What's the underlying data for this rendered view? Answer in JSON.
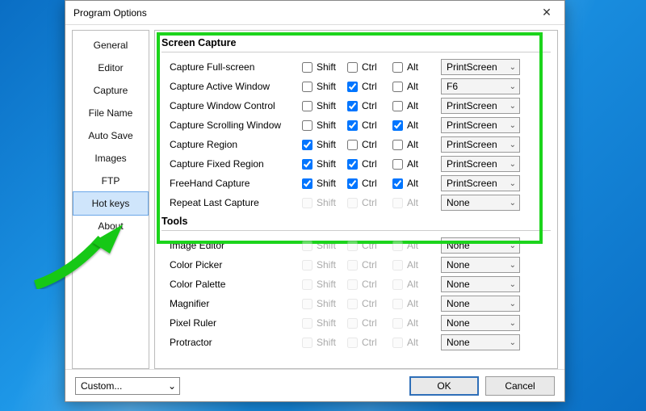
{
  "window": {
    "title": "Program Options"
  },
  "sidebar": {
    "items": [
      {
        "label": "General"
      },
      {
        "label": "Editor"
      },
      {
        "label": "Capture"
      },
      {
        "label": "File Name"
      },
      {
        "label": "Auto Save"
      },
      {
        "label": "Images"
      },
      {
        "label": "FTP"
      },
      {
        "label": "Hot keys",
        "selected": true
      },
      {
        "label": "About"
      }
    ]
  },
  "mods": {
    "shift": "Shift",
    "ctrl": "Ctrl",
    "alt": "Alt"
  },
  "sections": [
    {
      "title": "Screen Capture",
      "highlighted": true,
      "rows": [
        {
          "label": "Capture Full-screen",
          "shift": false,
          "ctrl": false,
          "alt": false,
          "key": "PrintScreen",
          "enabled": true
        },
        {
          "label": "Capture Active Window",
          "shift": false,
          "ctrl": true,
          "alt": false,
          "key": "F6",
          "enabled": true
        },
        {
          "label": "Capture Window Control",
          "shift": false,
          "ctrl": true,
          "alt": false,
          "key": "PrintScreen",
          "enabled": true
        },
        {
          "label": "Capture Scrolling Window",
          "shift": false,
          "ctrl": true,
          "alt": true,
          "key": "PrintScreen",
          "enabled": true
        },
        {
          "label": "Capture Region",
          "shift": true,
          "ctrl": false,
          "alt": false,
          "key": "PrintScreen",
          "enabled": true
        },
        {
          "label": "Capture Fixed Region",
          "shift": true,
          "ctrl": true,
          "alt": false,
          "key": "PrintScreen",
          "enabled": true
        },
        {
          "label": "FreeHand Capture",
          "shift": true,
          "ctrl": true,
          "alt": true,
          "key": "PrintScreen",
          "enabled": true
        },
        {
          "label": "Repeat Last Capture",
          "shift": false,
          "ctrl": false,
          "alt": false,
          "key": "None",
          "enabled": false
        }
      ]
    },
    {
      "title": "Tools",
      "rows": [
        {
          "label": "Image Editor",
          "shift": false,
          "ctrl": false,
          "alt": false,
          "key": "None",
          "enabled": false
        },
        {
          "label": "Color Picker",
          "shift": false,
          "ctrl": false,
          "alt": false,
          "key": "None",
          "enabled": false
        },
        {
          "label": "Color Palette",
          "shift": false,
          "ctrl": false,
          "alt": false,
          "key": "None",
          "enabled": false
        },
        {
          "label": "Magnifier",
          "shift": false,
          "ctrl": false,
          "alt": false,
          "key": "None",
          "enabled": false
        },
        {
          "label": "Pixel Ruler",
          "shift": false,
          "ctrl": false,
          "alt": false,
          "key": "None",
          "enabled": false
        },
        {
          "label": "Protractor",
          "shift": false,
          "ctrl": false,
          "alt": false,
          "key": "None",
          "enabled": false
        }
      ]
    }
  ],
  "footer": {
    "profile": "Custom...",
    "ok": "OK",
    "cancel": "Cancel"
  }
}
